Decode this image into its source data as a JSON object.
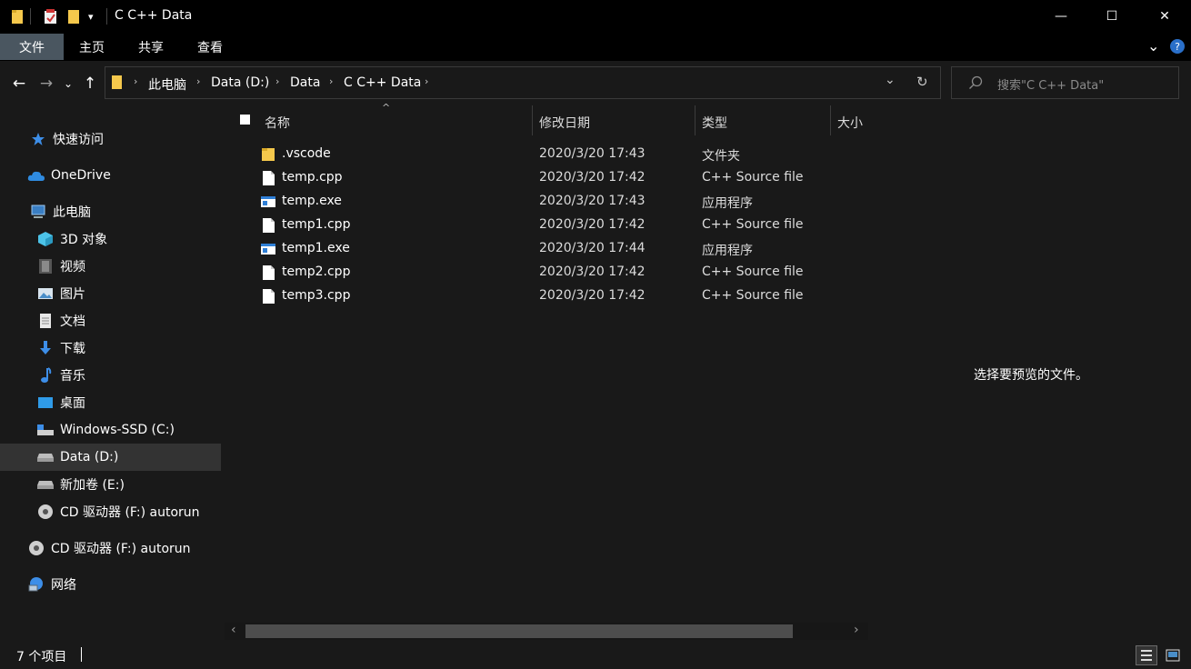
{
  "window": {
    "title": "C C++ Data",
    "minimize_glyph": "—",
    "maximize_glyph": "☐",
    "close_glyph": "✕",
    "qa_dropdown_glyph": "▾"
  },
  "ribbon": {
    "tabs": [
      {
        "label": "文件",
        "active": true
      },
      {
        "label": "主页",
        "active": false
      },
      {
        "label": "共享",
        "active": false
      },
      {
        "label": "查看",
        "active": false
      }
    ],
    "expand_glyph": "⌄",
    "help_glyph": "?"
  },
  "address": {
    "back_glyph": "←",
    "forward_glyph": "→",
    "recent_glyph": "⌄",
    "up_glyph": "↑",
    "breadcrumbs": [
      "此电脑",
      "Data (D:)",
      "Data",
      "C C++ Data"
    ],
    "separator": "›",
    "dropdown_glyph": "⌄",
    "refresh_glyph": "↻"
  },
  "search": {
    "placeholder": "搜索\"C C++ Data\""
  },
  "nav": {
    "items": [
      {
        "label": "快速访问",
        "icon": "star-icon"
      },
      {
        "label": "OneDrive",
        "icon": "cloud-icon"
      },
      {
        "label": "此电脑",
        "icon": "computer-icon"
      },
      {
        "label": "3D 对象",
        "icon": "cube-icon"
      },
      {
        "label": "视频",
        "icon": "video-icon"
      },
      {
        "label": "图片",
        "icon": "picture-icon"
      },
      {
        "label": "文档",
        "icon": "document-icon"
      },
      {
        "label": "下载",
        "icon": "download-icon"
      },
      {
        "label": "音乐",
        "icon": "music-icon"
      },
      {
        "label": "桌面",
        "icon": "desktop-icon"
      },
      {
        "label": "Windows-SSD (C:)",
        "icon": "system-drive-icon"
      },
      {
        "label": "Data (D:)",
        "icon": "drive-icon",
        "selected": true
      },
      {
        "label": "新加卷 (E:)",
        "icon": "drive-icon"
      },
      {
        "label": "CD 驱动器 (F:) autorun",
        "icon": "cd-drive-icon"
      },
      {
        "label": "CD 驱动器 (F:) autorun",
        "icon": "cd-drive-icon"
      },
      {
        "label": "网络",
        "icon": "network-icon"
      }
    ]
  },
  "list": {
    "headers": {
      "name": "名称",
      "modified": "修改日期",
      "type": "类型",
      "size": "大小"
    },
    "sort_glyph": "^",
    "files": [
      {
        "name": ".vscode",
        "modified": "2020/3/20 17:43",
        "type": "文件夹",
        "icon": "folder-icon"
      },
      {
        "name": "temp.cpp",
        "modified": "2020/3/20 17:42",
        "type": "C++ Source file",
        "icon": "file-icon"
      },
      {
        "name": "temp.exe",
        "modified": "2020/3/20 17:43",
        "type": "应用程序",
        "icon": "exe-icon"
      },
      {
        "name": "temp1.cpp",
        "modified": "2020/3/20 17:42",
        "type": "C++ Source file",
        "icon": "file-icon"
      },
      {
        "name": "temp1.exe",
        "modified": "2020/3/20 17:44",
        "type": "应用程序",
        "icon": "exe-icon"
      },
      {
        "name": "temp2.cpp",
        "modified": "2020/3/20 17:42",
        "type": "C++ Source file",
        "icon": "file-icon"
      },
      {
        "name": "temp3.cpp",
        "modified": "2020/3/20 17:42",
        "type": "C++ Source file",
        "icon": "file-icon"
      }
    ]
  },
  "scroll": {
    "left_glyph": "‹",
    "right_glyph": "›"
  },
  "preview": {
    "message": "选择要预览的文件。"
  },
  "status": {
    "item_count": "7 个项目"
  },
  "colors": {
    "background": "#191919",
    "titlebar": "#000000",
    "active_tab": "#4a5660",
    "folder": "#f5c84c",
    "selection": "#333333",
    "accent": "#0078d7"
  }
}
